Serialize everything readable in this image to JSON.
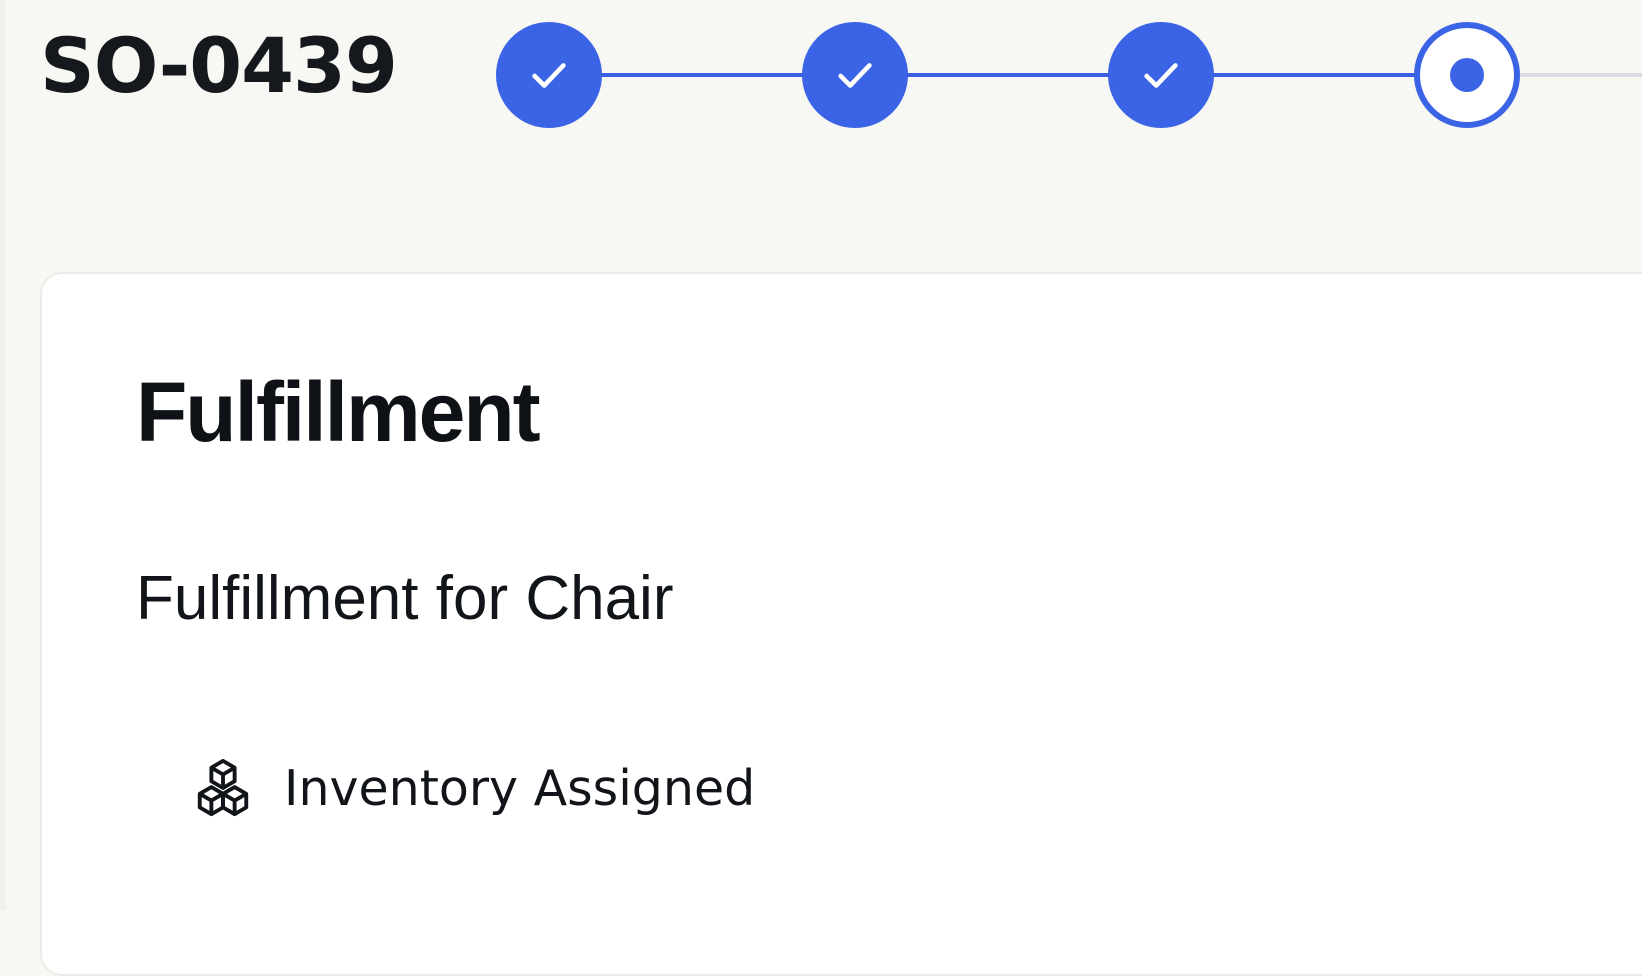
{
  "header": {
    "order_id": "SO-0439"
  },
  "stepper": {
    "steps": [
      {
        "state": "completed",
        "icon": "check-icon"
      },
      {
        "state": "completed",
        "icon": "check-icon"
      },
      {
        "state": "completed",
        "icon": "check-icon"
      },
      {
        "state": "current",
        "icon": "dot-icon"
      }
    ],
    "accent_color": "#3b63e6"
  },
  "card": {
    "title": "Fulfillment",
    "subtitle": "Fulfillment for Chair",
    "status": {
      "icon": "boxes-icon",
      "label": "Inventory Assigned"
    }
  }
}
